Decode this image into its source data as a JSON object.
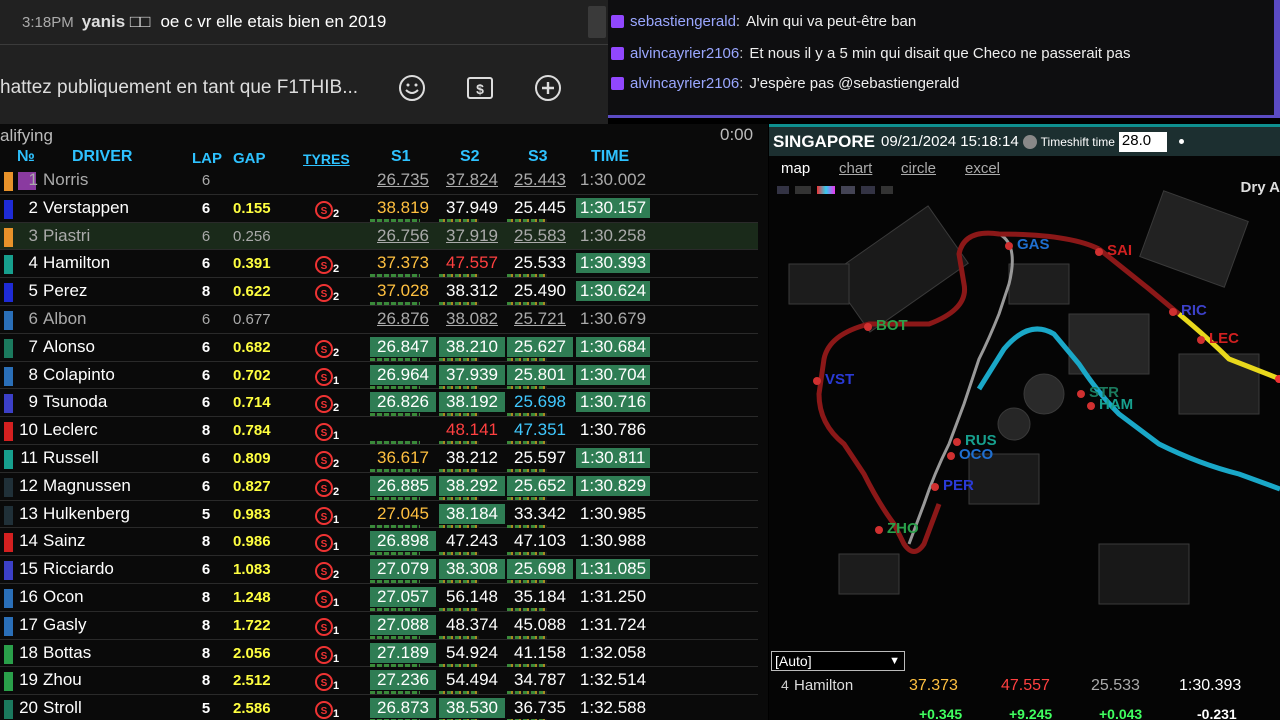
{
  "youtube": {
    "message": {
      "time": "3:18PM",
      "author": "yanis □□",
      "text": "oe c vr elle etais bien en 2019"
    },
    "input_placeholder": "hattez publiquement en tant que F1THIB..."
  },
  "twitch": {
    "messages": [
      {
        "name": "sebastiengerald",
        "text": "Alvin qui va peut-être ban"
      },
      {
        "name": "alvincayrier2106",
        "text": "Et nous il y a 5 min qui disait que Checo ne passerait pas"
      },
      {
        "name": "alvincayrier2106",
        "text": "J'espère pas @sebastiengerald"
      }
    ]
  },
  "timing": {
    "session": "alifying",
    "clock": "0:00",
    "headers": {
      "pos": "№",
      "driver": "DRIVER",
      "lap": "LAP",
      "gap": "GAP",
      "tyres": "TYRES",
      "s1": "S1",
      "s2": "S2",
      "s3": "S3",
      "time": "TIME"
    },
    "rows": [
      {
        "pos": "1",
        "name": "Norris",
        "lap": "6",
        "gap": "",
        "tyre": "",
        "s1": "26.735",
        "s2": "37.824",
        "s3": "25.443",
        "time": "1:30.002",
        "team": "#e8922a",
        "pit": true,
        "s1c": "#aaa",
        "s2c": "#aaa",
        "s3c": "#aaa",
        "tc": "#fff",
        "s1bg": "",
        "s2bg": "",
        "s3bg": "",
        "tbg": ""
      },
      {
        "pos": "2",
        "name": "Verstappen",
        "lap": "6",
        "gap": "0.155",
        "tyre": "2",
        "s1": "38.819",
        "s2": "37.949",
        "s3": "25.445",
        "time": "1:30.157",
        "team": "#1e2bd6",
        "pit": false,
        "s1c": "#ffc040",
        "s2c": "#fff",
        "s3c": "#fff",
        "tc": "#fff",
        "s1bg": "",
        "s2bg": "",
        "s3bg": "",
        "tbg": "#2f7d54"
      },
      {
        "pos": "3",
        "name": "Piastri",
        "lap": "6",
        "gap": "0.256",
        "tyre": "",
        "s1": "26.756",
        "s2": "37.919",
        "s3": "25.583",
        "time": "1:30.258",
        "team": "#e8922a",
        "pit": true,
        "s1c": "#aaa",
        "s2c": "#aaa",
        "s3c": "#aaa",
        "tc": "#fff",
        "s1bg": "",
        "s2bg": "",
        "s3bg": "",
        "tbg": "",
        "hl": true
      },
      {
        "pos": "4",
        "name": "Hamilton",
        "lap": "6",
        "gap": "0.391",
        "tyre": "2",
        "s1": "37.373",
        "s2": "47.557",
        "s3": "25.533",
        "time": "1:30.393",
        "team": "#17a08e",
        "pit": false,
        "s1c": "#ffc040",
        "s2c": "#ff4040",
        "s3c": "#fff",
        "tc": "#fff",
        "s1bg": "",
        "s2bg": "",
        "s3bg": "",
        "tbg": "#2f7d54"
      },
      {
        "pos": "5",
        "name": "Perez",
        "lap": "8",
        "gap": "0.622",
        "tyre": "2",
        "s1": "37.028",
        "s2": "38.312",
        "s3": "25.490",
        "time": "1:30.624",
        "team": "#1e2bd6",
        "pit": false,
        "s1c": "#ffc040",
        "s2c": "#fff",
        "s3c": "#fff",
        "tc": "#fff",
        "s1bg": "",
        "s2bg": "",
        "s3bg": "",
        "tbg": "#2f7d54"
      },
      {
        "pos": "6",
        "name": "Albon",
        "lap": "6",
        "gap": "0.677",
        "tyre": "",
        "s1": "26.876",
        "s2": "38.082",
        "s3": "25.721",
        "time": "1:30.679",
        "team": "#2a6fb8",
        "pit": true,
        "s1c": "#aaa",
        "s2c": "#aaa",
        "s3c": "#aaa",
        "tc": "#fff",
        "s1bg": "",
        "s2bg": "",
        "s3bg": "",
        "tbg": ""
      },
      {
        "pos": "7",
        "name": "Alonso",
        "lap": "6",
        "gap": "0.682",
        "tyre": "2",
        "s1": "26.847",
        "s2": "38.210",
        "s3": "25.627",
        "time": "1:30.684",
        "team": "#1b7a5e",
        "pit": false,
        "s1c": "#fff",
        "s2c": "#fff",
        "s3c": "#fff",
        "tc": "#fff",
        "s1bg": "#2f7d54",
        "s2bg": "#2f7d54",
        "s3bg": "#2f7d54",
        "tbg": "#2f7d54"
      },
      {
        "pos": "8",
        "name": "Colapinto",
        "lap": "6",
        "gap": "0.702",
        "tyre": "1",
        "s1": "26.964",
        "s2": "37.939",
        "s3": "25.801",
        "time": "1:30.704",
        "team": "#2a6fb8",
        "pit": false,
        "s1c": "#fff",
        "s2c": "#fff",
        "s3c": "#fff",
        "tc": "#fff",
        "s1bg": "#2f7d54",
        "s2bg": "#2f7d54",
        "s3bg": "#2f7d54",
        "tbg": "#2f7d54"
      },
      {
        "pos": "9",
        "name": "Tsunoda",
        "lap": "6",
        "gap": "0.714",
        "tyre": "2",
        "s1": "26.826",
        "s2": "38.192",
        "s3": "25.698",
        "time": "1:30.716",
        "team": "#3c40c8",
        "pit": false,
        "s1c": "#fff",
        "s2c": "#fff",
        "s3c": "#40c8ff",
        "tc": "#fff",
        "s1bg": "#2f7d54",
        "s2bg": "#2f7d54",
        "s3bg": "",
        "tbg": "#2f7d54"
      },
      {
        "pos": "10",
        "name": "Leclerc",
        "lap": "8",
        "gap": "0.784",
        "tyre": "1",
        "s1": "",
        "s2": "48.141",
        "s3": "47.351",
        "time": "1:30.786",
        "team": "#d42020",
        "pit": false,
        "s1c": "#fff",
        "s2c": "#ff4040",
        "s3c": "#40c8ff",
        "tc": "#fff",
        "s1bg": "",
        "s2bg": "",
        "s3bg": "",
        "tbg": ""
      },
      {
        "pos": "11",
        "name": "Russell",
        "lap": "6",
        "gap": "0.809",
        "tyre": "2",
        "s1": "36.617",
        "s2": "38.212",
        "s3": "25.597",
        "time": "1:30.811",
        "team": "#17a08e",
        "pit": false,
        "s1c": "#ffc040",
        "s2c": "#fff",
        "s3c": "#fff",
        "tc": "#fff",
        "s1bg": "",
        "s2bg": "",
        "s3bg": "",
        "tbg": "#2f7d54"
      },
      {
        "pos": "12",
        "name": "Magnussen",
        "lap": "6",
        "gap": "0.827",
        "tyre": "2",
        "s1": "26.885",
        "s2": "38.292",
        "s3": "25.652",
        "time": "1:30.829",
        "team": "#203038",
        "pit": false,
        "s1c": "#fff",
        "s2c": "#fff",
        "s3c": "#fff",
        "tc": "#fff",
        "s1bg": "#2f7d54",
        "s2bg": "#2f7d54",
        "s3bg": "#2f7d54",
        "tbg": "#2f7d54"
      },
      {
        "pos": "13",
        "name": "Hulkenberg",
        "lap": "5",
        "gap": "0.983",
        "tyre": "1",
        "s1": "27.045",
        "s2": "38.184",
        "s3": "33.342",
        "time": "1:30.985",
        "team": "#203038",
        "pit": false,
        "s1c": "#ffc040",
        "s2c": "#fff",
        "s3c": "#fff",
        "tc": "#fff",
        "s1bg": "",
        "s2bg": "#2f7d54",
        "s3bg": "",
        "tbg": ""
      },
      {
        "pos": "14",
        "name": "Sainz",
        "lap": "8",
        "gap": "0.986",
        "tyre": "1",
        "s1": "26.898",
        "s2": "47.243",
        "s3": "47.103",
        "time": "1:30.988",
        "team": "#d42020",
        "pit": false,
        "s1c": "#fff",
        "s2c": "#fff",
        "s3c": "#fff",
        "tc": "#fff",
        "s1bg": "#2f7d54",
        "s2bg": "",
        "s3bg": "",
        "tbg": ""
      },
      {
        "pos": "15",
        "name": "Ricciardo",
        "lap": "6",
        "gap": "1.083",
        "tyre": "2",
        "s1": "27.079",
        "s2": "38.308",
        "s3": "25.698",
        "time": "1:31.085",
        "team": "#3c40c8",
        "pit": false,
        "s1c": "#fff",
        "s2c": "#fff",
        "s3c": "#fff",
        "tc": "#fff",
        "s1bg": "#2f7d54",
        "s2bg": "#2f7d54",
        "s3bg": "#2f7d54",
        "tbg": "#2f7d54"
      },
      {
        "pos": "16",
        "name": "Ocon",
        "lap": "8",
        "gap": "1.248",
        "tyre": "1",
        "s1": "27.057",
        "s2": "56.148",
        "s3": "35.184",
        "time": "1:31.250",
        "team": "#2a6fb8",
        "pit": false,
        "s1c": "#fff",
        "s2c": "#fff",
        "s3c": "#fff",
        "tc": "#fff",
        "s1bg": "#2f7d54",
        "s2bg": "",
        "s3bg": "",
        "tbg": ""
      },
      {
        "pos": "17",
        "name": "Gasly",
        "lap": "8",
        "gap": "1.722",
        "tyre": "1",
        "s1": "27.088",
        "s2": "48.374",
        "s3": "45.088",
        "time": "1:31.724",
        "team": "#2a6fb8",
        "pit": false,
        "s1c": "#fff",
        "s2c": "#fff",
        "s3c": "#fff",
        "tc": "#fff",
        "s1bg": "#2f7d54",
        "s2bg": "",
        "s3bg": "",
        "tbg": ""
      },
      {
        "pos": "18",
        "name": "Bottas",
        "lap": "8",
        "gap": "2.056",
        "tyre": "1",
        "s1": "27.189",
        "s2": "54.924",
        "s3": "41.158",
        "time": "1:32.058",
        "team": "#2aa04a",
        "pit": false,
        "s1c": "#fff",
        "s2c": "#fff",
        "s3c": "#fff",
        "tc": "#fff",
        "s1bg": "#2f7d54",
        "s2bg": "",
        "s3bg": "",
        "tbg": ""
      },
      {
        "pos": "19",
        "name": "Zhou",
        "lap": "8",
        "gap": "2.512",
        "tyre": "1",
        "s1": "27.236",
        "s2": "54.494",
        "s3": "34.787",
        "time": "1:32.514",
        "team": "#2aa04a",
        "pit": false,
        "s1c": "#fff",
        "s2c": "#fff",
        "s3c": "#fff",
        "tc": "#fff",
        "s1bg": "#2f7d54",
        "s2bg": "",
        "s3bg": "",
        "tbg": ""
      },
      {
        "pos": "20",
        "name": "Stroll",
        "lap": "5",
        "gap": "2.586",
        "tyre": "1",
        "s1": "26.873",
        "s2": "38.530",
        "s3": "36.735",
        "time": "1:32.588",
        "team": "#1b7a5e",
        "pit": false,
        "s1c": "#fff",
        "s2c": "#fff",
        "s3c": "#fff",
        "tc": "#fff",
        "s1bg": "#2f7d54",
        "s2bg": "#2f7d54",
        "s3bg": "",
        "tbg": ""
      }
    ]
  },
  "map_panel": {
    "city": "SINGAPORE",
    "datetime": "09/21/2024 15:18:14",
    "timeshift_label": "Timeshift time",
    "timeshift_value": "28.0",
    "tabs": [
      "map",
      "chart",
      "circle",
      "excel"
    ],
    "weather": "Dry A",
    "select_value": "[Auto]",
    "drivers_on_map": [
      "GAS",
      "SAI",
      "RIC",
      "LEC",
      "BOT",
      "VST",
      "STR",
      "HAM",
      "RUS",
      "OCO",
      "PER",
      "ZHO"
    ],
    "focus": {
      "pos": "4",
      "name": "Hamilton",
      "s1": "37.373",
      "s2": "47.557",
      "s3": "25.533",
      "time": "1:30.393"
    },
    "deltas": {
      "s1": "+0.345",
      "s2": "+9.245",
      "s3": "+0.043",
      "time": "-0.231"
    }
  }
}
